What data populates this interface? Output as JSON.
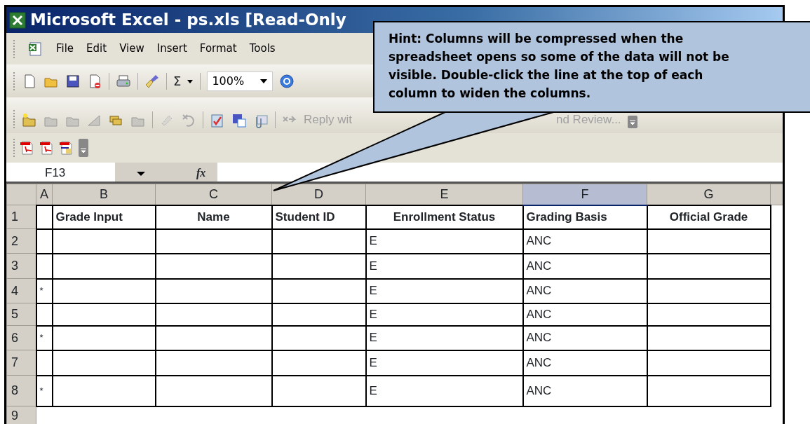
{
  "window": {
    "title": "Microsoft Excel - ps.xls  [Read-Only"
  },
  "menu_bar": {
    "items": [
      "File",
      "Edit",
      "View",
      "Insert",
      "Format",
      "Tools"
    ]
  },
  "standard_toolbar": {
    "autosum_symbol": "Σ",
    "zoom": "100%"
  },
  "reviewing_toolbar": {
    "reply_label": "Reply wit",
    "end_review_label": "nd Review..."
  },
  "formula_bar": {
    "name_box": "F13",
    "function_label": "fx"
  },
  "sheet": {
    "columns": [
      {
        "label": "A",
        "selected": false
      },
      {
        "label": "B",
        "selected": false
      },
      {
        "label": "C",
        "selected": false
      },
      {
        "label": "D",
        "selected": false
      },
      {
        "label": "E",
        "selected": false
      },
      {
        "label": "F",
        "selected": true
      },
      {
        "label": "G",
        "selected": false
      }
    ],
    "header_row": {
      "number": "1",
      "labels": [
        "Grade Input",
        "Name",
        "Student ID",
        "Enrollment Status",
        "Grading Basis",
        "Official Grade"
      ]
    },
    "rows": [
      {
        "number": "2",
        "enrollment_status": "E",
        "grading_basis": "ANC"
      },
      {
        "number": "3",
        "enrollment_status": "E",
        "grading_basis": "ANC"
      },
      {
        "number": "4",
        "column_a": "*",
        "enrollment_status": "E",
        "grading_basis": "ANC"
      },
      {
        "number": "5",
        "enrollment_status": "E",
        "grading_basis": "ANC"
      },
      {
        "number": "6",
        "column_a": "*",
        "enrollment_status": "E",
        "grading_basis": "ANC"
      },
      {
        "number": "7",
        "enrollment_status": "E",
        "grading_basis": "ANC"
      },
      {
        "number": "8",
        "column_a": "*",
        "enrollment_status": "E",
        "grading_basis": "ANC"
      },
      {
        "number": "9"
      }
    ]
  },
  "callout": {
    "text": "Hint: Columns will be compressed when the spreadsheet opens so some of the data will not be visible. Double-click the line at the top of each column to widen the columns."
  }
}
